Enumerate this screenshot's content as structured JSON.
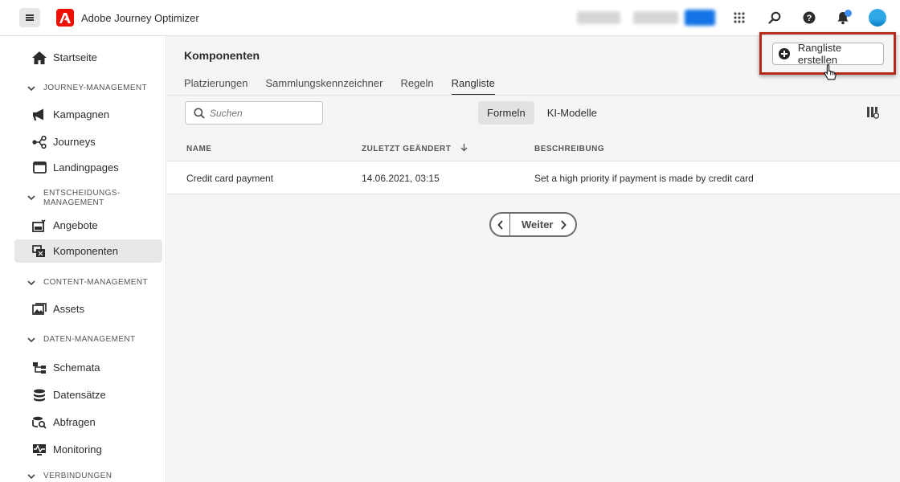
{
  "app": {
    "title": "Adobe Journey Optimizer"
  },
  "topbar": {
    "org_blur_1": "CJM Stage",
    "org_blur_2": "Prod (VA7)",
    "org_badge": "Prod"
  },
  "sidebar": {
    "home": "Startseite",
    "sections": {
      "journey": "JOURNEY-MANAGEMENT",
      "decision_1": "ENTSCHEIDUNGS-",
      "decision_2": "MANAGEMENT",
      "content": "CONTENT-MANAGEMENT",
      "data": "DATEN-MANAGEMENT",
      "connections": "VERBINDUNGEN"
    },
    "items": {
      "campaigns": "Kampagnen",
      "journeys": "Journeys",
      "landingpages": "Landingpages",
      "offers": "Angebote",
      "components": "Komponenten",
      "assets": "Assets",
      "schemas": "Schemata",
      "datasets": "Datensätze",
      "queries": "Abfragen",
      "monitoring": "Monitoring"
    }
  },
  "main": {
    "title": "Komponenten",
    "create_button": "Rangliste erstellen",
    "tabs": [
      "Platzierungen",
      "Sammlungskennzeichner",
      "Regeln",
      "Rangliste"
    ],
    "search_placeholder": "Suchen",
    "segments": {
      "formulas": "Formeln",
      "ai_models": "KI-Modelle"
    },
    "columns": {
      "name": "NAME",
      "modified": "ZULETZT GEÄNDERT",
      "description": "BESCHREIBUNG"
    },
    "rows": [
      {
        "name": "Credit card payment",
        "modified": "14.06.2021, 03:15",
        "description": "Set a high priority if payment is made by credit card"
      }
    ],
    "pager_next": "Weiter"
  },
  "colors": {
    "accent_red": "#eb1000",
    "highlight_border": "#b42a1d",
    "badge_blue": "#1473e6"
  }
}
